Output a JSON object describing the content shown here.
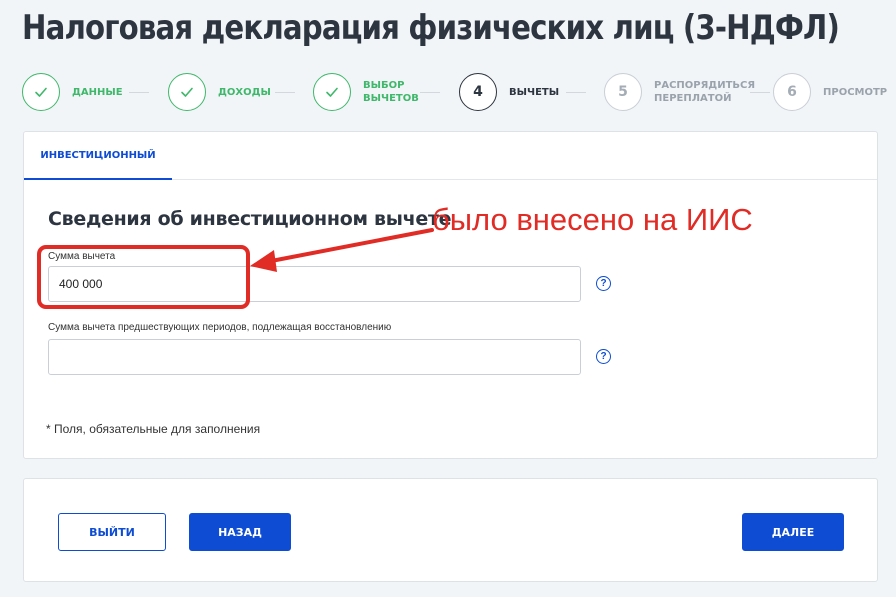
{
  "page": {
    "title": "Налоговая декларация физических лиц (3-НДФЛ)"
  },
  "stepper": {
    "steps": [
      {
        "label": "Данные",
        "number": "",
        "state": "done",
        "icon": "check-icon"
      },
      {
        "label": "Доходы",
        "number": "",
        "state": "done",
        "icon": "check-icon"
      },
      {
        "label": "Выбор\nвычетов",
        "number": "",
        "state": "done",
        "icon": "check-icon"
      },
      {
        "label": "Вычеты",
        "number": "4",
        "state": "current"
      },
      {
        "label": "Распорядиться\nпереплатой",
        "number": "5",
        "state": "pending"
      },
      {
        "label": "Просмотр",
        "number": "6",
        "state": "pending"
      }
    ]
  },
  "tabs": [
    {
      "label": "Инвестиционный",
      "active": true
    }
  ],
  "section": {
    "title": "Сведения об инвестиционном вычете"
  },
  "fields": {
    "deduction_amount": {
      "label": "Сумма вычета",
      "value": "400 000",
      "help_icon": "question-icon"
    },
    "prior_restore": {
      "label": "Сумма вычета предшествующих периодов, подлежащая восстановлению",
      "value": "",
      "help_icon": "question-icon"
    }
  },
  "help_glyph": "?",
  "required_note": "* Поля, обязательные для заполнения",
  "annotation": {
    "text": "было внесено на ИИС",
    "color": "#e12b25"
  },
  "footer": {
    "exit_label": "Выйти",
    "back_label": "Назад",
    "next_label": "Далее"
  },
  "colors": {
    "accent": "#0d4cd3",
    "done": "#3fb86b",
    "title": "#2d3540",
    "annotation": "#e12b25"
  }
}
